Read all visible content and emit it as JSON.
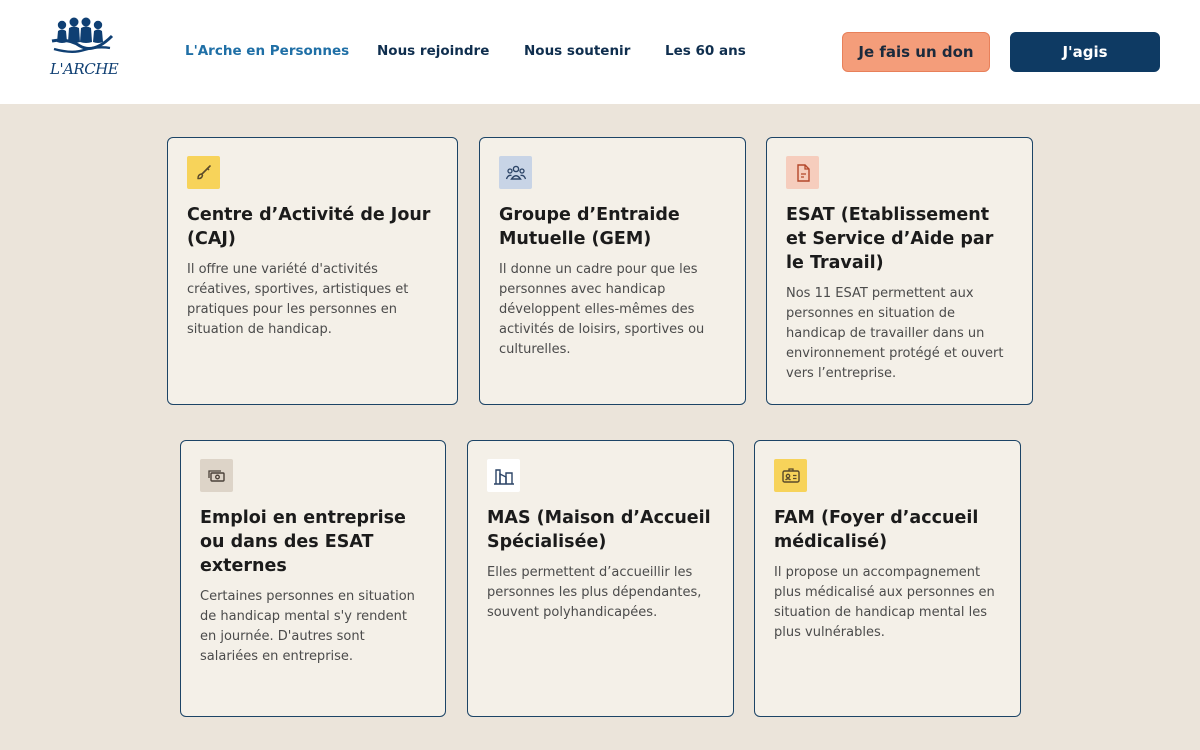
{
  "header": {
    "logo_text": "L'ARCHE",
    "nav": [
      {
        "label": "L'Arche en Personnes",
        "active": true
      },
      {
        "label": "Nous rejoindre",
        "active": false
      },
      {
        "label": "Nous soutenir",
        "active": false
      },
      {
        "label": "Les 60 ans",
        "active": false
      }
    ],
    "donate_label": "Je fais un don",
    "act_label": "J'agis"
  },
  "colors": {
    "donate_bg": "#f49d7a",
    "act_bg": "#0e3a63",
    "page_bg": "#ebe4da",
    "card_bg": "#f4f0e8",
    "card_border": "#1c4466",
    "nav_active": "#1f6fa6"
  },
  "cards": [
    {
      "icon": "paintbrush-icon",
      "icon_bg": "#f7d35a",
      "title": "Centre d’Activité de Jour (CAJ)",
      "text": "Il offre une variété d'activités créatives, sportives, artistiques et pratiques pour les personnes en situation de handicap."
    },
    {
      "icon": "group-icon",
      "icon_bg": "#c8d4e6",
      "title": "Groupe d’Entraide Mutuelle (GEM)",
      "text": "Il donne un cadre pour que les personnes avec handicap développent elles-mêmes des activités de loisirs, sportives ou culturelles."
    },
    {
      "icon": "document-icon",
      "icon_bg": "#f6cdbd",
      "title": "ESAT (Etablissement et Service d’Aide par le Travail)",
      "text": "Nos 11 ESAT permettent aux personnes en situation de handicap de travailler dans un environnement protégé et ouvert vers l’entreprise."
    },
    {
      "icon": "money-icon",
      "icon_bg": "#ddd4c8",
      "title": "Emploi en entreprise ou dans des ESAT externes",
      "text": "Certaines personnes en situation de handicap mental s'y rendent en journée. D'autres sont salariées en entreprise."
    },
    {
      "icon": "building-icon",
      "icon_bg": "#ffffff",
      "title": "MAS (Maison d’Accueil Spécialisée)",
      "text": "Elles permettent d’accueillir les personnes les plus dépendantes, souvent polyhandicapées."
    },
    {
      "icon": "id-card-icon",
      "icon_bg": "#f7d35a",
      "title": "FAM (Foyer d’accueil médicalisé)",
      "text": "Il propose un accompagnement plus médicalisé aux personnes en situation de handicap mental les plus vulnérables."
    }
  ]
}
